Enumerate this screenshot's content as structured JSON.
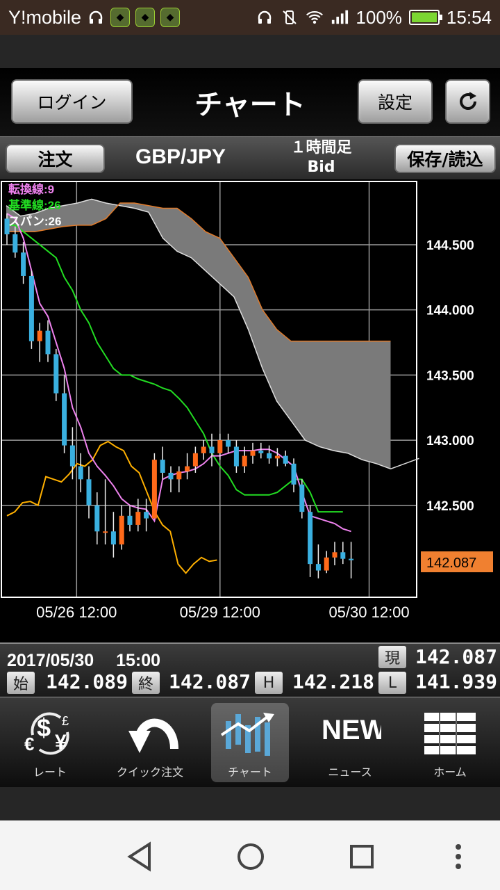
{
  "status_bar": {
    "carrier": "Y!mobile",
    "battery": "100%",
    "time": "15:54"
  },
  "header": {
    "login_label": "ログイン",
    "title": "チャート",
    "settings_label": "設定"
  },
  "toolbar": {
    "order_label": "注文",
    "pair": "GBP/JPY",
    "timeframe_line1": "１時間足",
    "timeframe_line2": "Bid",
    "save_load_label": "保存/読込"
  },
  "indicators": {
    "tenkan": "転換線:9",
    "kijun": "基準線:26",
    "span": "スパン:26"
  },
  "chart_data": {
    "type": "candlestick",
    "y_ticks": [
      "144.500",
      "144.000",
      "143.500",
      "143.000",
      "142.500"
    ],
    "x_labels": [
      "05/26 12:00",
      "05/29 12:00",
      "05/30 12:00"
    ],
    "current_price": "142.087",
    "ylim": [
      141.8,
      144.98
    ],
    "colors": {
      "up": "#ff6a1a",
      "down": "#3ab0e0",
      "tenkan": "#ee82ee",
      "kijun": "#22dd22",
      "chikou": "#ffb000",
      "cloud": "#7a7a7a",
      "span_a": "#dddddd",
      "span_b": "#e07a2a"
    },
    "candles": [
      [
        144.7,
        144.74,
        144.5,
        144.58
      ],
      [
        144.58,
        144.64,
        144.4,
        144.44
      ],
      [
        144.44,
        144.52,
        144.2,
        144.26
      ],
      [
        144.26,
        144.3,
        143.7,
        143.76
      ],
      [
        143.76,
        143.9,
        143.6,
        143.84
      ],
      [
        143.84,
        143.92,
        143.6,
        143.66
      ],
      [
        143.66,
        143.7,
        143.3,
        143.36
      ],
      [
        143.36,
        143.5,
        142.9,
        142.96
      ],
      [
        142.96,
        143.1,
        142.7,
        142.8
      ],
      [
        142.8,
        142.9,
        142.6,
        142.7
      ],
      [
        142.7,
        142.8,
        142.4,
        142.5
      ],
      [
        142.5,
        142.6,
        142.2,
        142.3
      ],
      [
        142.3,
        142.7,
        142.2,
        142.3
      ],
      [
        142.3,
        142.45,
        142.1,
        142.2
      ],
      [
        142.2,
        142.5,
        142.16,
        142.42
      ],
      [
        142.42,
        142.5,
        142.3,
        142.35
      ],
      [
        142.35,
        142.55,
        142.3,
        142.45
      ],
      [
        142.45,
        142.55,
        142.3,
        142.4
      ],
      [
        142.4,
        142.9,
        142.4,
        142.85
      ],
      [
        142.85,
        142.95,
        142.7,
        142.75
      ],
      [
        142.75,
        142.8,
        142.6,
        142.7
      ],
      [
        142.7,
        142.8,
        142.6,
        142.76
      ],
      [
        142.76,
        142.9,
        142.7,
        142.8
      ],
      [
        142.8,
        142.95,
        142.75,
        142.9
      ],
      [
        142.9,
        143.0,
        142.85,
        142.95
      ],
      [
        142.95,
        143.05,
        142.8,
        142.9
      ],
      [
        142.9,
        143.05,
        142.85,
        143.0
      ],
      [
        143.0,
        143.05,
        142.9,
        142.95
      ],
      [
        142.95,
        143.0,
        142.75,
        142.8
      ],
      [
        142.8,
        142.95,
        142.75,
        142.88
      ],
      [
        142.88,
        142.98,
        142.82,
        142.92
      ],
      [
        142.92,
        142.98,
        142.86,
        142.9
      ],
      [
        142.9,
        142.96,
        142.82,
        142.86
      ],
      [
        142.86,
        142.94,
        142.8,
        142.88
      ],
      [
        142.88,
        142.92,
        142.8,
        142.82
      ],
      [
        142.82,
        142.86,
        142.6,
        142.66
      ],
      [
        142.66,
        142.7,
        142.4,
        142.45
      ],
      [
        142.45,
        142.5,
        141.95,
        142.05
      ],
      [
        142.05,
        142.2,
        141.94,
        142.0
      ],
      [
        142.0,
        142.15,
        141.98,
        142.1
      ],
      [
        142.1,
        142.22,
        142.04,
        142.14
      ],
      [
        142.14,
        142.22,
        142.05,
        142.09
      ],
      [
        142.09,
        142.22,
        141.94,
        142.087
      ]
    ],
    "tenkan": [
      144.74,
      144.7,
      144.55,
      144.3,
      144.05,
      143.95,
      143.75,
      143.55,
      143.25,
      143.1,
      142.9,
      142.8,
      142.73,
      142.65,
      142.55,
      142.5,
      142.48,
      142.47,
      142.38,
      142.7,
      142.73,
      142.75,
      142.76,
      142.78,
      142.82,
      142.88,
      142.88,
      142.9,
      142.92,
      142.92,
      142.92,
      142.93,
      142.93,
      142.9,
      142.85,
      142.8,
      142.6,
      142.42,
      142.4,
      142.38,
      142.36,
      142.32,
      142.3
    ],
    "kijun": [
      144.65,
      144.65,
      144.6,
      144.55,
      144.5,
      144.45,
      144.4,
      144.25,
      144.15,
      144.0,
      143.9,
      143.75,
      143.65,
      143.55,
      143.5,
      143.5,
      143.47,
      143.45,
      143.43,
      143.4,
      143.38,
      143.32,
      143.25,
      143.15,
      143.05,
      142.9,
      142.8,
      142.73,
      142.62,
      142.58,
      142.58,
      142.58,
      142.58,
      142.6,
      142.65,
      142.7,
      142.7,
      142.6,
      142.45,
      142.45,
      142.45,
      142.45
    ],
    "chikou": [
      142.42,
      142.45,
      142.52,
      142.53,
      142.5,
      142.72,
      142.7,
      142.68,
      142.74,
      142.82,
      142.8,
      142.85,
      142.96,
      142.99,
      142.95,
      142.92,
      142.8,
      142.75,
      142.6,
      142.45,
      142.35,
      142.3,
      142.05,
      141.98,
      142.05,
      142.1,
      142.07,
      142.08
    ],
    "span_b": [
      144.6,
      144.6,
      144.6,
      144.62,
      144.64,
      144.65,
      144.65,
      144.7,
      144.82,
      144.82,
      144.8,
      144.78,
      144.78,
      144.7,
      144.6,
      144.55,
      144.4,
      144.25,
      144.0,
      143.85,
      143.76,
      143.76,
      143.76,
      143.76,
      143.76,
      143.76,
      143.76,
      143.76
    ],
    "span_a": [
      144.8,
      144.72,
      144.74,
      144.78,
      144.8,
      144.82,
      144.85,
      144.82,
      144.8,
      144.78,
      144.75,
      144.55,
      144.45,
      144.4,
      144.3,
      144.2,
      144.1,
      143.85,
      143.55,
      143.3,
      143.15,
      143.0,
      142.95,
      142.92,
      142.9,
      142.85,
      142.82,
      142.78,
      142.82,
      142.86
    ]
  },
  "info": {
    "datetime": "2017/05/30　 15:00",
    "current_tag": "現",
    "current_value": "142.087",
    "open_tag": "始",
    "open_value": "142.089",
    "close_tag": "終",
    "close_value": "142.087",
    "high_tag": "H",
    "high_value": "142.218",
    "low_tag": "L",
    "low_value": "141.939"
  },
  "nav": {
    "rate": "レート",
    "quick_order": "クイック注文",
    "chart": "チャート",
    "news": "ニュース",
    "home": "ホーム",
    "news_icon_text": "NEWS"
  }
}
